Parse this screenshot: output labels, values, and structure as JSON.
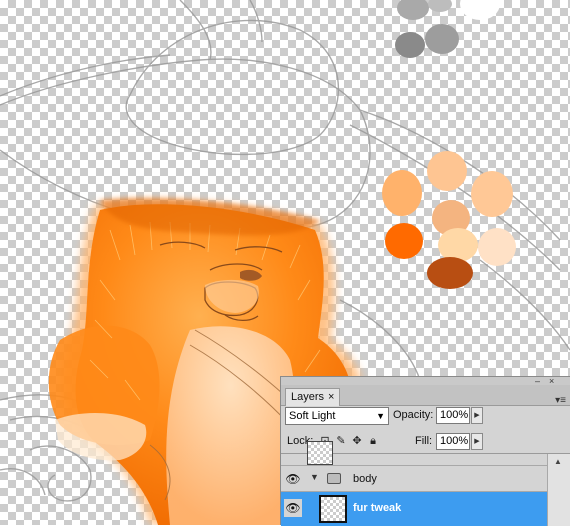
{
  "layers_panel": {
    "tab_label": "Layers",
    "tab_close": "×",
    "blend_mode": "Soft Light",
    "opacity_label": "Opacity:",
    "opacity_value": "100%",
    "lock_label": "Lock:",
    "fill_label": "Fill:",
    "fill_value": "100%",
    "layers": [
      {
        "name": "body",
        "type": "group",
        "expanded": true
      },
      {
        "name": "fur tweak",
        "type": "layer",
        "selected": true
      }
    ]
  },
  "swatches": {
    "grays": [
      "#a9a9a9",
      "#ffffff",
      "#8a8a8a",
      "#9d9d9d"
    ],
    "oranges": [
      "#ffb26b",
      "#fec592",
      "#ffc896",
      "#ff9f3b",
      "#f4b480",
      "#ffe1c6",
      "#ff6a00",
      "#ffd8a6",
      "#b84e12"
    ]
  },
  "colors": {
    "selection": "#3d9cf0",
    "fur": "#ff8a1c"
  }
}
